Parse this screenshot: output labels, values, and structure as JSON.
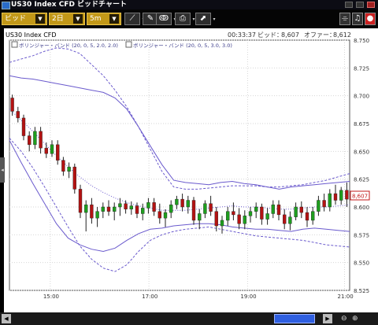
{
  "window": {
    "title": "US30 Index CFD ビッドチャート"
  },
  "toolbar": {
    "price_type": "ビッド",
    "period": "2日",
    "interval": "5m"
  },
  "chart": {
    "symbol": "US30 Index CFD",
    "time": "00:33:37",
    "bid_label": "ビッド：",
    "bid": "8,607",
    "offer_label": "オファー：",
    "offer": "8,612",
    "legend": [
      "ボリンジャー・バンド (20, 0, 5, 2.0, 2.0)",
      "ボリンジャー・バンド (20, 0, 5, 3.0, 3.0)"
    ],
    "y_ticks": [
      "8.750",
      "8.725",
      "8.700",
      "8.675",
      "8.650",
      "8.625",
      "8.600",
      "8.575",
      "8.550",
      "8.525"
    ],
    "x_ticks": [
      "15:00",
      "17:00",
      "19:00",
      "21:00"
    ],
    "current_price_label": "8,607"
  },
  "colors": {
    "candle_up": "#1e9e1e",
    "candle_down": "#b31212",
    "band": "#6a5acd",
    "background": "#ffffff",
    "grid": "#d6d6d6"
  },
  "chart_data": {
    "type": "candlestick",
    "ylim": [
      8525,
      8750
    ],
    "x_ticks": [
      "15:00",
      "17:00",
      "19:00",
      "21:00"
    ],
    "last": 8607,
    "bollinger_2sd": {
      "upper": [
        8718,
        8716,
        8715,
        8713,
        8711,
        8709,
        8707,
        8705,
        8703,
        8698,
        8688,
        8672,
        8655,
        8638,
        8624,
        8622,
        8621,
        8620,
        8622,
        8623,
        8621,
        8620,
        8618,
        8616,
        8618,
        8619,
        8620,
        8621,
        8622,
        8623
      ],
      "middle": [
        8688,
        8678,
        8668,
        8657,
        8646,
        8636,
        8627,
        8619,
        8613,
        8608,
        8604,
        8601,
        8599,
        8597,
        8597,
        8597,
        8598,
        8599,
        8600,
        8601,
        8600,
        8600,
        8599,
        8598,
        8598,
        8599,
        8600,
        8600,
        8601,
        8602
      ],
      "lower": [
        8660,
        8640,
        8621,
        8603,
        8585,
        8572,
        8566,
        8562,
        8560,
        8563,
        8570,
        8576,
        8580,
        8581,
        8583,
        8584,
        8585,
        8585,
        8584,
        8582,
        8581,
        8580,
        8580,
        8579,
        8578,
        8580,
        8581,
        8580,
        8579,
        8578
      ]
    },
    "bollinger_3sd": {
      "upper": [
        8730,
        8733,
        8736,
        8740,
        8743,
        8742,
        8738,
        8728,
        8718,
        8705,
        8690,
        8672,
        8652,
        8632,
        8618,
        8616,
        8616,
        8617,
        8618,
        8619,
        8619,
        8619,
        8618,
        8618,
        8619,
        8620,
        8622,
        8624,
        8627,
        8630
      ],
      "lower": [
        8662,
        8650,
        8635,
        8618,
        8600,
        8582,
        8565,
        8553,
        8545,
        8542,
        8548,
        8560,
        8570,
        8575,
        8578,
        8580,
        8581,
        8582,
        8580,
        8578,
        8576,
        8574,
        8573,
        8572,
        8571,
        8570,
        8568,
        8566,
        8565,
        8564
      ]
    },
    "candles": [
      [
        8698,
        8701,
        8682,
        8686
      ],
      [
        8686,
        8690,
        8676,
        8680
      ],
      [
        8680,
        8683,
        8660,
        8664
      ],
      [
        8664,
        8668,
        8650,
        8656
      ],
      [
        8656,
        8672,
        8652,
        8668
      ],
      [
        8668,
        8672,
        8648,
        8653
      ],
      [
        8653,
        8658,
        8644,
        8648
      ],
      [
        8648,
        8660,
        8645,
        8656
      ],
      [
        8656,
        8660,
        8638,
        8642
      ],
      [
        8642,
        8645,
        8628,
        8632
      ],
      [
        8632,
        8640,
        8626,
        8636
      ],
      [
        8636,
        8639,
        8612,
        8616
      ],
      [
        8616,
        8620,
        8590,
        8595
      ],
      [
        8595,
        8606,
        8578,
        8602
      ],
      [
        8602,
        8608,
        8585,
        8590
      ],
      [
        8590,
        8600,
        8582,
        8596
      ],
      [
        8596,
        8604,
        8590,
        8600
      ],
      [
        8600,
        8606,
        8592,
        8596
      ],
      [
        8596,
        8604,
        8588,
        8600
      ],
      [
        8600,
        8608,
        8592,
        8603
      ],
      [
        8603,
        8606,
        8594,
        8598
      ],
      [
        8598,
        8605,
        8593,
        8601
      ],
      [
        8601,
        8604,
        8590,
        8594
      ],
      [
        8594,
        8603,
        8588,
        8599
      ],
      [
        8599,
        8608,
        8594,
        8604
      ],
      [
        8604,
        8608,
        8592,
        8596
      ],
      [
        8596,
        8603,
        8585,
        8590
      ],
      [
        8590,
        8598,
        8582,
        8595
      ],
      [
        8595,
        8606,
        8590,
        8602
      ],
      [
        8602,
        8610,
        8598,
        8607
      ],
      [
        8607,
        8612,
        8596,
        8600
      ],
      [
        8600,
        8610,
        8594,
        8606
      ],
      [
        8606,
        8609,
        8584,
        8588
      ],
      [
        8588,
        8598,
        8580,
        8594
      ],
      [
        8594,
        8606,
        8590,
        8603
      ],
      [
        8603,
        8610,
        8592,
        8596
      ],
      [
        8596,
        8600,
        8578,
        8583
      ],
      [
        8583,
        8592,
        8576,
        8588
      ],
      [
        8588,
        8600,
        8583,
        8596
      ],
      [
        8596,
        8604,
        8588,
        8593
      ],
      [
        8593,
        8599,
        8580,
        8585
      ],
      [
        8585,
        8597,
        8580,
        8592
      ],
      [
        8592,
        8600,
        8586,
        8596
      ],
      [
        8596,
        8604,
        8590,
        8600
      ],
      [
        8600,
        8603,
        8584,
        8589
      ],
      [
        8589,
        8599,
        8584,
        8594
      ],
      [
        8594,
        8606,
        8590,
        8602
      ],
      [
        8602,
        8606,
        8588,
        8593
      ],
      [
        8593,
        8598,
        8580,
        8585
      ],
      [
        8585,
        8596,
        8579,
        8591
      ],
      [
        8591,
        8604,
        8588,
        8600
      ],
      [
        8600,
        8605,
        8590,
        8595
      ],
      [
        8595,
        8600,
        8582,
        8588
      ],
      [
        8588,
        8600,
        8584,
        8596
      ],
      [
        8596,
        8610,
        8592,
        8606
      ],
      [
        8606,
        8612,
        8596,
        8600
      ],
      [
        8600,
        8616,
        8596,
        8612
      ],
      [
        8612,
        8620,
        8602,
        8606
      ],
      [
        8606,
        8618,
        8602,
        8615
      ],
      [
        8615,
        8622,
        8600,
        8607
      ]
    ]
  }
}
